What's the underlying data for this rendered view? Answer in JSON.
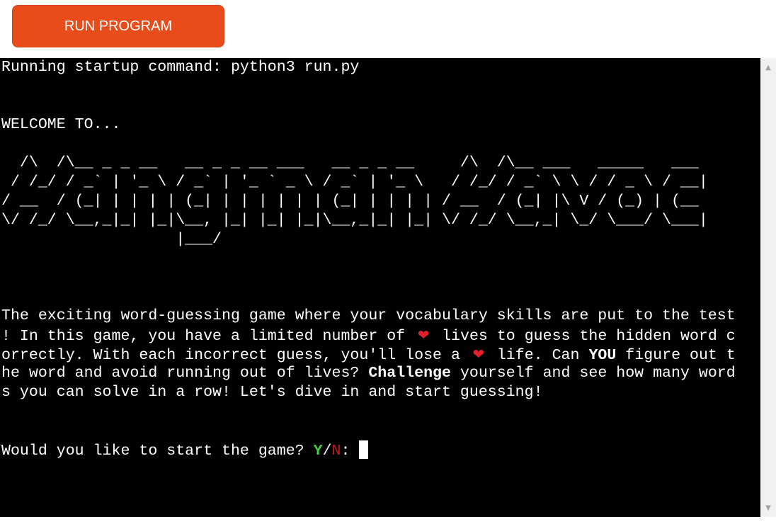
{
  "run_button": {
    "label": "RUN PROGRAM"
  },
  "terminal": {
    "startup_line": "Running startup command: python3 run.py",
    "welcome": "WELCOME TO...",
    "ascii_art": [
      "  /\\  /\\__ _ _ __   __ _ _ __ ___   __ _ _ __     /\\  /\\__ ___   _____   ___",
      " / /_/ / _` | '_ \\ / _` | '_ ` _ \\ / _` | '_ \\   / /_/ / _` \\ \\ / / _ \\ / __|",
      "/ __  / (_| | | | | (_| | | | | | | (_| | | | | / __  / (_| |\\ V / (_) | (__",
      "\\/ /_/ \\__,_|_| |_|\\__, |_| |_| |_|\\__,_|_| |_| \\/ /_/ \\__,_| \\_/ \\___/ \\___|",
      "                   |___/"
    ],
    "intro_lines": {
      "l1": "The exciting word-guessing game where your vocabulary skills are put to the test",
      "l2_a": "! In this game, you have a limited number of ",
      "l2_b": " lives to guess the hidden word c",
      "l3_a": "orrectly. With each incorrect guess, you'll lose a ",
      "l3_b": " life. Can ",
      "l3_bold": "YOU",
      "l3_c": " figure out t",
      "l4_a": "he word and avoid running out of lives? ",
      "l4_bold": "Challenge",
      "l4_b": " yourself and see how many word",
      "l5": "s you can solve in a row! Let's dive in and start guessing!"
    },
    "heart_glyph": "❤",
    "prompt": {
      "text": "Would you like to start the game? ",
      "yes": "Y",
      "slash": "/",
      "no": "N",
      "colon": ": "
    }
  },
  "colors": {
    "button": "#e84c1a",
    "terminal_bg": "#000000",
    "yes": "#3fcf3f",
    "no": "#c21b1b",
    "heart": "#e0202a"
  }
}
